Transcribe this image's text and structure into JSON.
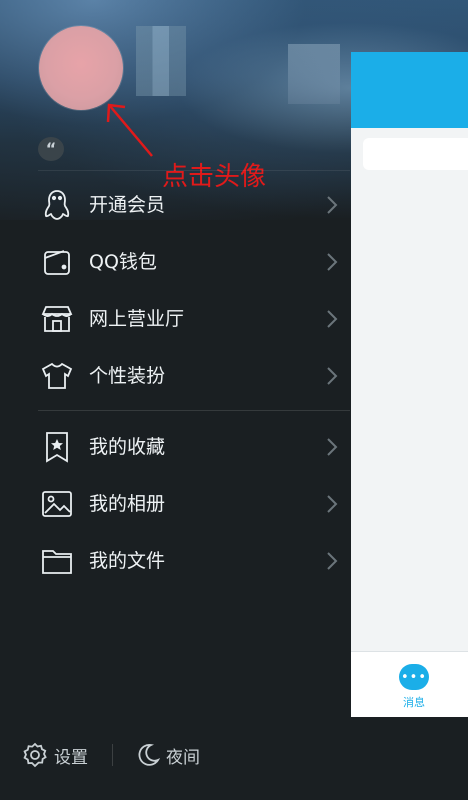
{
  "annotation": {
    "text": "点击头像"
  },
  "signature": {
    "icon": "quote-icon",
    "glyph": "“"
  },
  "menu": {
    "items": [
      {
        "label": "开通会员",
        "icon": "penguin-icon"
      },
      {
        "label": "QQ钱包",
        "icon": "wallet-icon"
      },
      {
        "label": "网上营业厅",
        "icon": "store-icon"
      },
      {
        "label": "个性装扮",
        "icon": "tshirt-icon"
      },
      {
        "label": "我的收藏",
        "icon": "bookmark-star-icon"
      },
      {
        "label": "我的相册",
        "icon": "photo-icon"
      },
      {
        "label": "我的文件",
        "icon": "folder-icon"
      }
    ]
  },
  "bottom": {
    "settings_label": "设置",
    "night_label": "夜间"
  },
  "right_panel": {
    "tab_label": "消息",
    "tab_glyph": "•••"
  },
  "colors": {
    "accent": "#1baee8",
    "annotation": "#e01a1a",
    "drawer_bg": "#1a1f22",
    "text": "#eef2f4"
  }
}
